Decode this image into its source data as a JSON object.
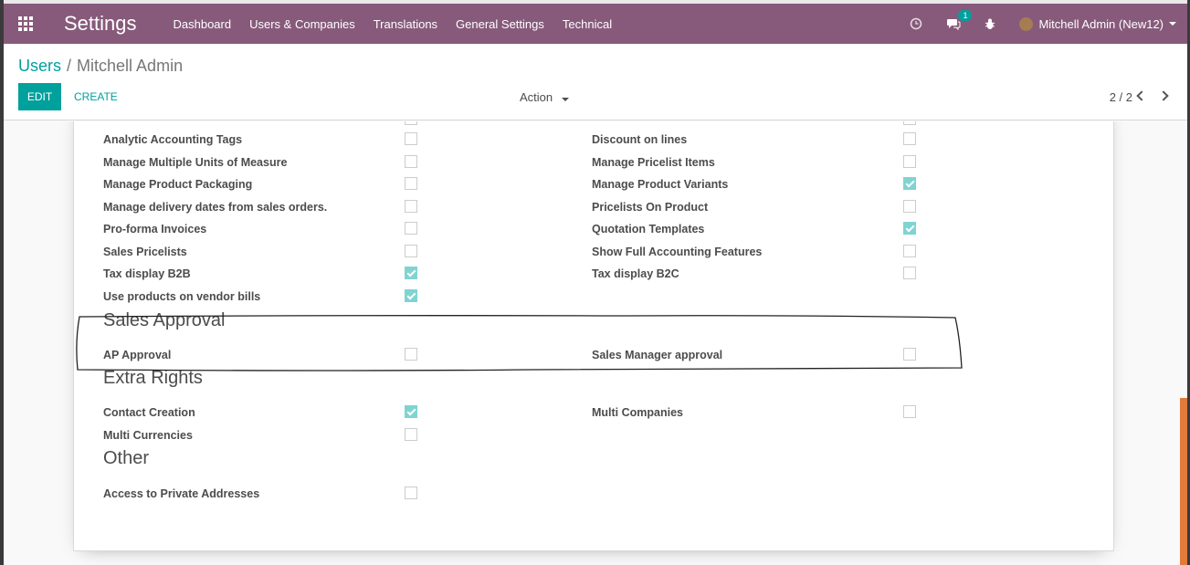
{
  "navbar": {
    "app_title": "Settings",
    "menu": [
      "Dashboard",
      "Users & Companies",
      "Translations",
      "General Settings",
      "Technical"
    ],
    "messages_badge": "1",
    "user_name": "Mitchell Admin (New12)",
    "accent_color": "#875a7b"
  },
  "control_panel": {
    "breadcrumb_parent": "Users",
    "breadcrumb_sep": "/",
    "breadcrumb_current": "Mitchell Admin",
    "edit_label": "EDIT",
    "create_label": "CREATE",
    "action_label": "Action",
    "pager": "2 / 2"
  },
  "technical_settings": {
    "left": [
      {
        "label": "Analytic Accounting Tags",
        "checked": false
      },
      {
        "label": "Manage Multiple Units of Measure",
        "checked": false
      },
      {
        "label": "Manage Product Packaging",
        "checked": false
      },
      {
        "label": "Manage delivery dates from sales orders.",
        "checked": false
      },
      {
        "label": "Pro-forma Invoices",
        "checked": false
      },
      {
        "label": "Sales Pricelists",
        "checked": false
      },
      {
        "label": "Tax display B2B",
        "checked": true
      },
      {
        "label": "Use products on vendor bills",
        "checked": true
      }
    ],
    "right": [
      {
        "label": "Discount on lines",
        "checked": false
      },
      {
        "label": "Manage Pricelist Items",
        "checked": false
      },
      {
        "label": "Manage Product Variants",
        "checked": true
      },
      {
        "label": "Pricelists On Product",
        "checked": false
      },
      {
        "label": "Quotation Templates",
        "checked": true
      },
      {
        "label": "Show Full Accounting Features",
        "checked": false
      },
      {
        "label": "Tax display B2C",
        "checked": false
      }
    ]
  },
  "sales_approval": {
    "title": "Sales Approval",
    "left": [
      {
        "label": "AP Approval",
        "checked": false
      }
    ],
    "right": [
      {
        "label": "Sales Manager approval",
        "checked": false
      }
    ]
  },
  "extra_rights": {
    "title": "Extra Rights",
    "left": [
      {
        "label": "Contact Creation",
        "checked": true
      },
      {
        "label": "Multi Currencies",
        "checked": false
      }
    ],
    "right": [
      {
        "label": "Multi Companies",
        "checked": false
      }
    ]
  },
  "other": {
    "title": "Other",
    "left": [
      {
        "label": "Access to Private Addresses",
        "checked": false
      }
    ]
  }
}
